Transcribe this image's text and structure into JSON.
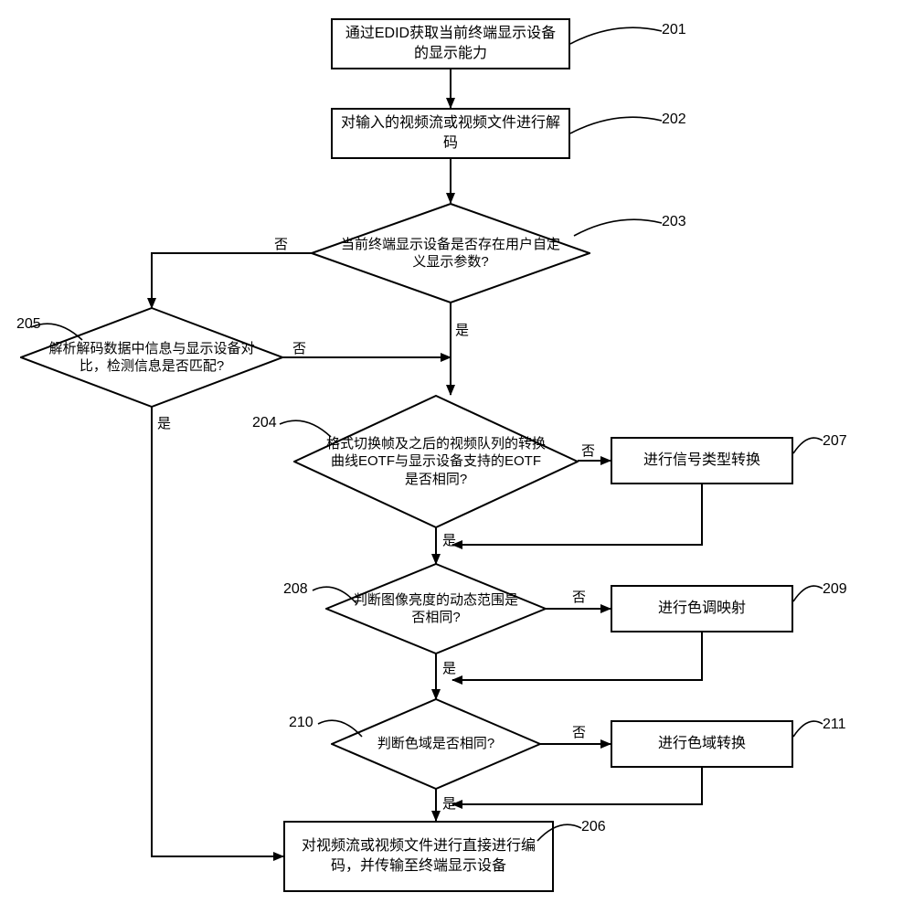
{
  "nodes": {
    "n201": "通过EDID获取当前终端显示设备的显示能力",
    "n202": "对输入的视频流或视频文件进行解码",
    "n203": "当前终端显示设备是否存在用户自定义显示参数?",
    "n204": "格式切换帧及之后的视频队列的转换曲线EOTF与显示设备支持的EOTF是否相同?",
    "n205": "解析解码数据中信息与显示设备对比，检测信息是否匹配?",
    "n206": "对视频流或视频文件进行直接进行编码，并传输至终端显示设备",
    "n207": "进行信号类型转换",
    "n208": "判断图像亮度的动态范围是否相同?",
    "n209": "进行色调映射",
    "n210": "判断色域是否相同?",
    "n211": "进行色域转换"
  },
  "steps": {
    "s201": "201",
    "s202": "202",
    "s203": "203",
    "s204": "204",
    "s205": "205",
    "s206": "206",
    "s207": "207",
    "s208": "208",
    "s209": "209",
    "s210": "210",
    "s211": "211"
  },
  "edges": {
    "yes": "是",
    "no": "否"
  },
  "chart_data": {
    "type": "flowchart",
    "nodes": [
      {
        "id": "201",
        "shape": "process",
        "text_key": "nodes.n201"
      },
      {
        "id": "202",
        "shape": "process",
        "text_key": "nodes.n202"
      },
      {
        "id": "203",
        "shape": "decision",
        "text_key": "nodes.n203"
      },
      {
        "id": "205",
        "shape": "decision",
        "text_key": "nodes.n205"
      },
      {
        "id": "204",
        "shape": "decision",
        "text_key": "nodes.n204"
      },
      {
        "id": "207",
        "shape": "process",
        "text_key": "nodes.n207"
      },
      {
        "id": "208",
        "shape": "decision",
        "text_key": "nodes.n208"
      },
      {
        "id": "209",
        "shape": "process",
        "text_key": "nodes.n209"
      },
      {
        "id": "210",
        "shape": "decision",
        "text_key": "nodes.n210"
      },
      {
        "id": "211",
        "shape": "process",
        "text_key": "nodes.n211"
      },
      {
        "id": "206",
        "shape": "process",
        "text_key": "nodes.n206"
      }
    ],
    "edges": [
      {
        "from": "201",
        "to": "202",
        "label": null
      },
      {
        "from": "202",
        "to": "203",
        "label": null
      },
      {
        "from": "203",
        "to": "205",
        "label": "否"
      },
      {
        "from": "203",
        "to": "204",
        "label": "是"
      },
      {
        "from": "205",
        "to": "204",
        "label": "否"
      },
      {
        "from": "205",
        "to": "206",
        "label": "是"
      },
      {
        "from": "204",
        "to": "207",
        "label": "否"
      },
      {
        "from": "204",
        "to": "208",
        "label": "是"
      },
      {
        "from": "207",
        "to": "208",
        "label": null
      },
      {
        "from": "208",
        "to": "209",
        "label": "否"
      },
      {
        "from": "208",
        "to": "210",
        "label": "是"
      },
      {
        "from": "209",
        "to": "210",
        "label": null
      },
      {
        "from": "210",
        "to": "211",
        "label": "否"
      },
      {
        "from": "210",
        "to": "206",
        "label": "是"
      },
      {
        "from": "211",
        "to": "206",
        "label": null
      }
    ]
  }
}
